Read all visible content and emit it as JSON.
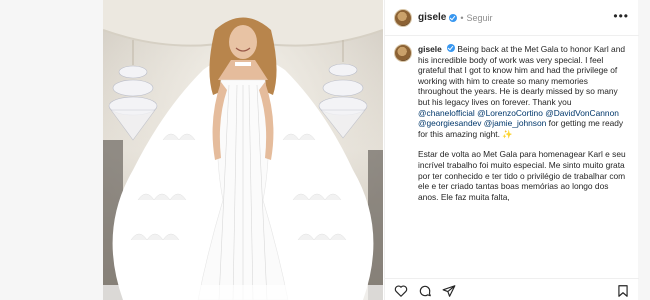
{
  "post": {
    "username": "gisele",
    "separator": "•",
    "follow_status": "Seguir",
    "more": "•••"
  },
  "caption": {
    "username": "gisele",
    "english_text": "Being back at the Met Gala to honor Karl and his incredible body of work was very special. I feel grateful that I got to know him and had the privilege of working with him to create so many memories throughout the years. He is dearly missed by so many but his legacy lives on forever. Thank you",
    "mention_chanel": "@chanelofficial",
    "mention_lorenzo": "@LorenzoCortino",
    "mention_david": "@DavidVonCannon",
    "mention_georgie": "@georgiesandev",
    "mention_jamie": "@jamie_johnson",
    "english_end": "for getting me ready for this amazing night. ✨",
    "portuguese_text": "Estar de volta ao Met Gala para homenagear Karl e seu incrível trabalho foi muito especial. Me sinto muito grata por ter conhecido e ter tido o privilégio de trabalhar com ele e ter criado tantas boas memórias ao longo dos anos. Ele faz muita falta,"
  },
  "icons": {
    "avatar": "profile-photo",
    "verified": "verified-badge-icon",
    "like": "heart-icon",
    "comment": "comment-icon",
    "share": "share-icon",
    "save": "bookmark-icon"
  },
  "colors": {
    "verified_blue": "#3897f0",
    "mention_blue": "#00376b",
    "text": "#262626",
    "muted": "#8e8e8e"
  }
}
